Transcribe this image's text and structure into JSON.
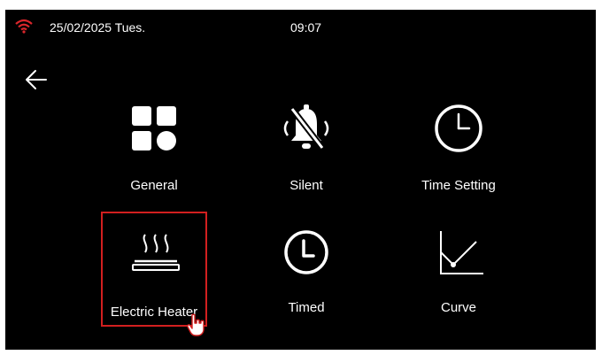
{
  "status": {
    "date": "25/02/2025 Tues.",
    "time": "09:07",
    "wifi_icon": "wifi-icon",
    "wifi_color": "#d9262b"
  },
  "nav": {
    "back_icon": "back-arrow-icon"
  },
  "menu": {
    "items": [
      {
        "label": "General",
        "icon": "grid-icon"
      },
      {
        "label": "Silent",
        "icon": "bell-muted-icon"
      },
      {
        "label": "Time Setting",
        "icon": "clock-icon"
      },
      {
        "label": "Electric Heater",
        "icon": "heater-icon",
        "selected": true
      },
      {
        "label": "Timed",
        "icon": "timer-icon"
      },
      {
        "label": "Curve",
        "icon": "curve-chart-icon"
      }
    ],
    "selection_color": "#d21f1f"
  }
}
